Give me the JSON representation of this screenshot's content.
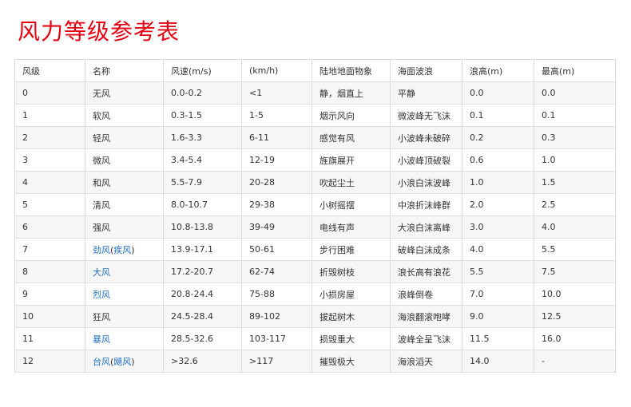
{
  "title": "风力等级参考表",
  "headers": [
    "风级",
    "名称",
    "风速(m/s)",
    "(km/h)",
    "陆地地面物象",
    "海面波浪",
    "浪高(m)",
    "最高(m)"
  ],
  "rows": [
    {
      "level": "0",
      "name": "无风",
      "ms": "0.0-0.2",
      "kmh": "<1",
      "land": "静，烟直上",
      "sea": "平静",
      "wave": "0.0",
      "max": "0.0"
    },
    {
      "level": "1",
      "name": "软风",
      "ms": "0.3-1.5",
      "kmh": "1-5",
      "land": "烟示风向",
      "sea": "微波峰无飞沫",
      "wave": "0.1",
      "max": "0.1"
    },
    {
      "level": "2",
      "name": "轻风",
      "ms": "1.6-3.3",
      "kmh": "6-11",
      "land": "感觉有风",
      "sea": "小波峰未破碎",
      "wave": "0.2",
      "max": "0.3"
    },
    {
      "level": "3",
      "name": "微风",
      "ms": "3.4-5.4",
      "kmh": "12-19",
      "land": "旌旗展开",
      "sea": "小波峰顶破裂",
      "wave": "0.6",
      "max": "1.0"
    },
    {
      "level": "4",
      "name": "和风",
      "ms": "5.5-7.9",
      "kmh": "20-28",
      "land": "吹起尘土",
      "sea": "小浪白沫波峰",
      "wave": "1.0",
      "max": "1.5"
    },
    {
      "level": "5",
      "name": "清风",
      "ms": "8.0-10.7",
      "kmh": "29-38",
      "land": "小树摇摆",
      "sea": "中浪折沫峰群",
      "wave": "2.0",
      "max": "2.5"
    },
    {
      "level": "6",
      "name": "强风",
      "ms": "10.8-13.8",
      "kmh": "39-49",
      "land": "电线有声",
      "sea": "大浪白沫离峰",
      "wave": "3.0",
      "max": "4.0"
    },
    {
      "level": "7",
      "name": "劲风",
      "alt": "疾风",
      "ms": "13.9-17.1",
      "kmh": "50-61",
      "land": "步行困难",
      "sea": "破峰白沫成条",
      "wave": "4.0",
      "max": "5.5"
    },
    {
      "level": "8",
      "name": "大风",
      "ms": "17.2-20.7",
      "kmh": "62-74",
      "land": "折毁树枝",
      "sea": "浪长高有浪花",
      "wave": "5.5",
      "max": "7.5"
    },
    {
      "level": "9",
      "name": "烈风",
      "ms": "20.8-24.4",
      "kmh": "75-88",
      "land": "小损房屋",
      "sea": "浪峰倒卷",
      "wave": "7.0",
      "max": "10.0"
    },
    {
      "level": "10",
      "name": "狂风",
      "ms": "24.5-28.4",
      "kmh": "89-102",
      "land": "拔起树木",
      "sea": "海浪翻滚咆哮",
      "wave": "9.0",
      "max": "12.5"
    },
    {
      "level": "11",
      "name": "暴风",
      "ms": "28.5-32.6",
      "kmh": "103-117",
      "land": "损毁重大",
      "sea": "波峰全呈飞沫",
      "wave": "11.5",
      "max": "16.0"
    },
    {
      "level": "12",
      "name": "台风",
      "alt": "飓风",
      "ms": ">32.6",
      "kmh": ">117",
      "land": "摧毁极大",
      "sea": "海浪滔天",
      "wave": "14.0",
      "max": "-"
    }
  ],
  "links": [
    {
      "name": true,
      "alt": true
    },
    {
      "name": true,
      "alt": false
    },
    {
      "name": true,
      "alt": false
    },
    {
      "name": true,
      "alt": false
    },
    {
      "name": true,
      "alt": true
    }
  ],
  "link_rows": {
    "7": {
      "name": true,
      "alt": true
    },
    "8": {
      "name": true
    },
    "9": {
      "name": true
    },
    "11": {
      "name": true
    },
    "12": {
      "name": true,
      "alt": true
    }
  },
  "paren_open": "(",
  "paren_close": ")",
  "colors": {
    "title": "#e60012",
    "link": "#1e6fc6",
    "stripe": "#f6f6f6",
    "border": "#dddddd"
  }
}
